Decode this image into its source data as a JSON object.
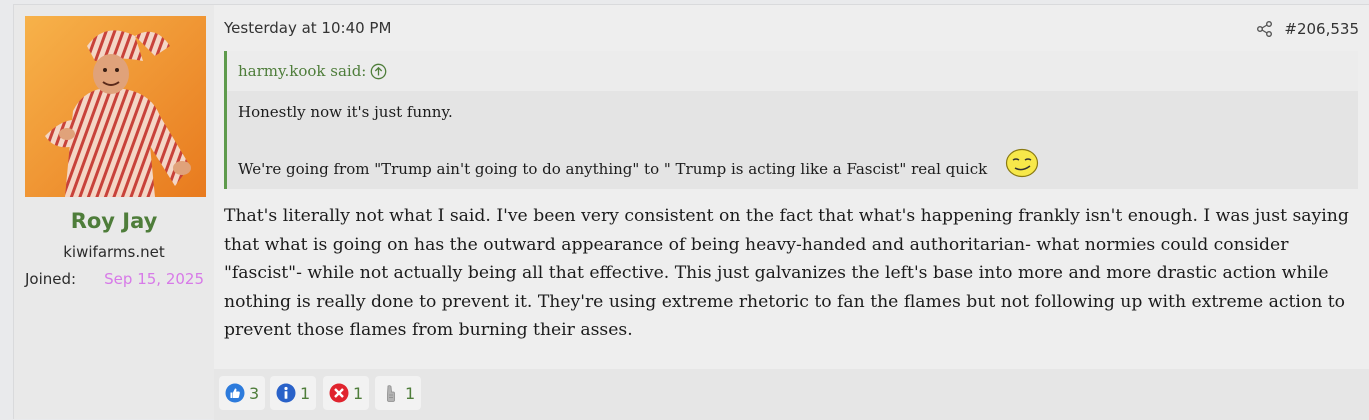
{
  "user": {
    "name": "Roy Jay",
    "title": "kiwifarms.net",
    "joined_label": "Joined:",
    "joined_date": "Sep 15, 2025"
  },
  "post": {
    "date": "Yesterday at 10:40 PM",
    "number": "#206,535",
    "body": "That's literally not what I said. I've been very consistent on the fact that what's happening frankly isn't enough. I was just saying that what is going on has the outward appearance of being heavy-handed and authoritarian- what normies could consider \"fascist\"- while not actually being all that effective. This just galvanizes the left's base into more and more drastic action while nothing is really done to prevent it. They're using extreme rhetoric to fan the flames but not following up with extreme action to prevent those flames from burning their asses."
  },
  "quote": {
    "author": "harmy.kook said:",
    "line1": "Honestly now it's just funny.",
    "line2": "We're going from \"Trump ain't going to do anything\" to \" Trump is acting like a Fascist\" real quick"
  },
  "reactions": [
    {
      "icon": "thumbs-up-icon",
      "count": "3"
    },
    {
      "icon": "info-icon",
      "count": "1"
    },
    {
      "icon": "x-mark-icon",
      "count": "1"
    },
    {
      "icon": "thumb-grey-icon",
      "count": "1"
    }
  ],
  "colors": {
    "username": "#4e7d3a",
    "joined_date": "#d77ae8",
    "quote_border": "#5e9a4c"
  }
}
